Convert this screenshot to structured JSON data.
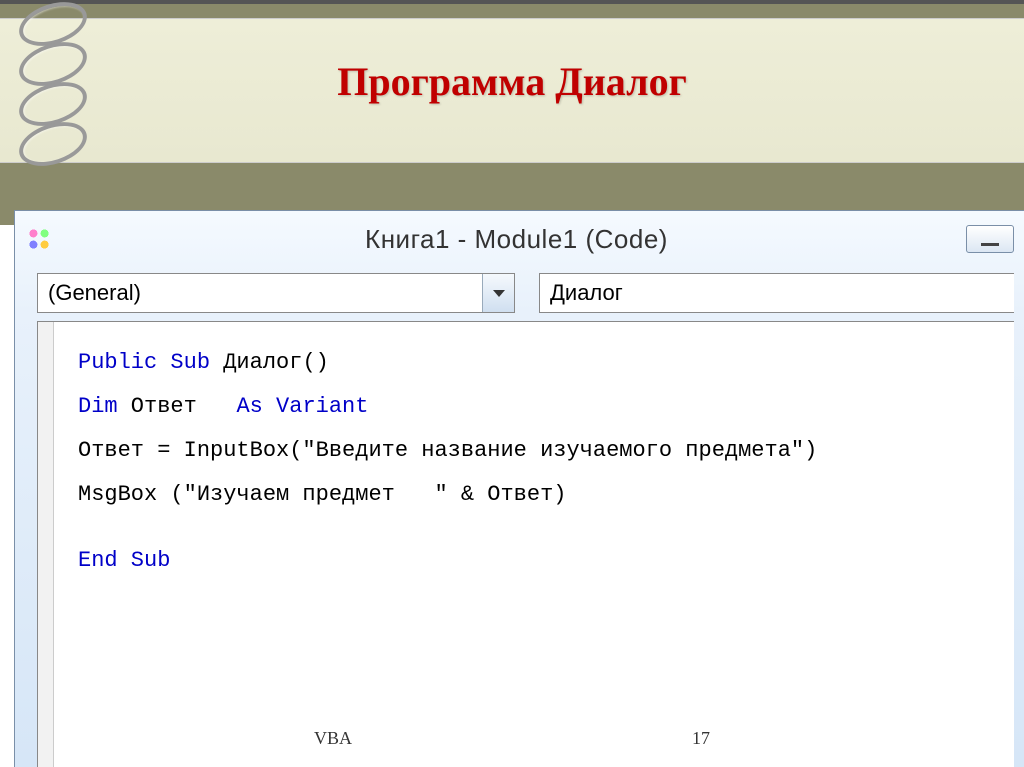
{
  "slide": {
    "title": "Программа Диалог",
    "footer_label": "VBA",
    "page_number": "17"
  },
  "editor": {
    "window_title": "Книга1 - Module1 (Code)",
    "object_dropdown": "(General)",
    "proc_dropdown": "Диалог"
  },
  "code": {
    "tokens": [
      {
        "t": "Public Sub",
        "c": "kw"
      },
      {
        "t": " Диалог()\n\n"
      },
      {
        "t": "Dim",
        "c": "kw"
      },
      {
        "t": " Ответ   "
      },
      {
        "t": "As Variant",
        "c": "kw"
      },
      {
        "t": "\n\n"
      },
      {
        "t": "Ответ = InputBox(\"Введите название изучаемого предмета\")\n\n"
      },
      {
        "t": "MsgBox (\"Изучаем предмет   \" & Ответ)\n\n\n"
      },
      {
        "t": "End Sub",
        "c": "kw"
      }
    ]
  }
}
